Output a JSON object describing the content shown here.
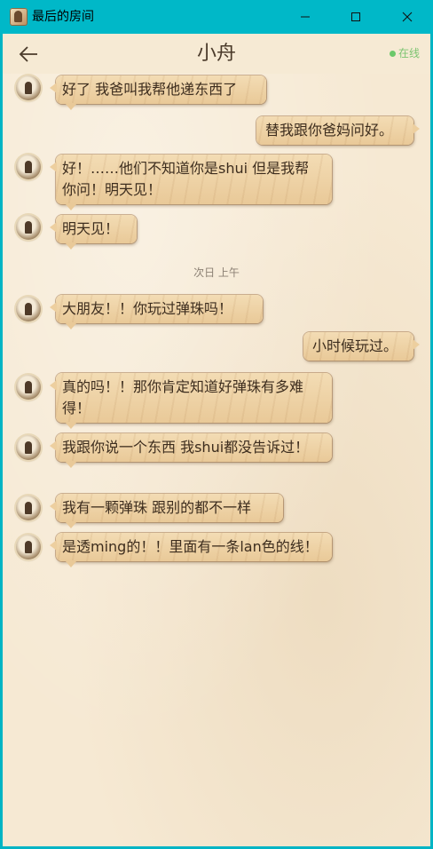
{
  "window": {
    "title": "最后的房间"
  },
  "header": {
    "contact_name": "小舟",
    "status": "在线"
  },
  "messages": [
    {
      "text": "好了 我爸叫我帮他递东西了"
    },
    {
      "text": "替我跟你爸妈问好。"
    },
    {
      "text": "好！……他们不知道你是shui 但是我帮你问！明天见！"
    },
    {
      "text": "明天见！"
    },
    {
      "text": "大朋友！！你玩过弹珠吗！"
    },
    {
      "text": "小时候玩过。"
    },
    {
      "text": "真的吗！！那你肯定知道好弹珠有多难得！"
    },
    {
      "text": "我跟你说一个东西 我shui都没告诉过！"
    },
    {
      "text": "我有一颗弹珠 跟别的都不一样"
    },
    {
      "text": "是透ming的！！里面有一条lan色的线！"
    }
  ],
  "divider": "次日 上午",
  "colors": {
    "titlebar": "#00b8c8",
    "paper": "#f6e9d3",
    "bubble": "#e9c998",
    "online": "#6cc86a"
  }
}
